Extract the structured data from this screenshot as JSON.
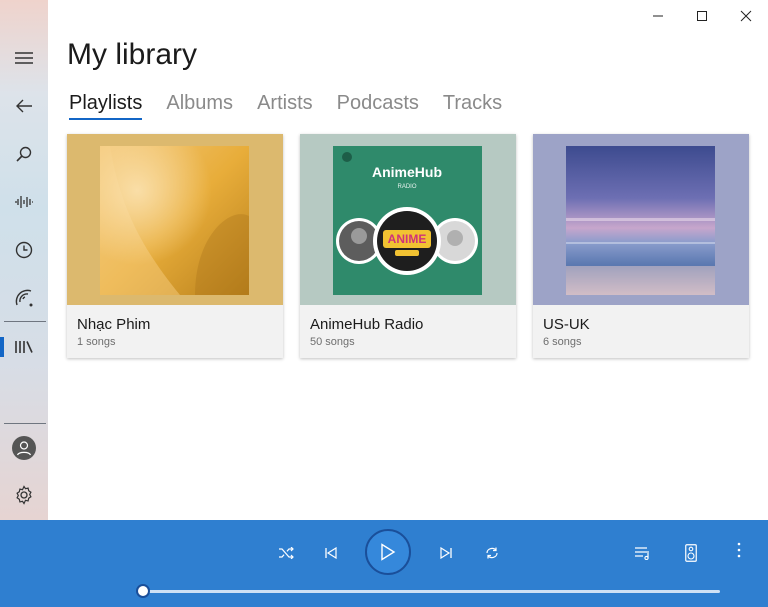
{
  "window": {
    "minimize_label": "Minimize",
    "maximize_label": "Maximize",
    "close_label": "Close"
  },
  "page": {
    "title": "My library"
  },
  "tabs": [
    {
      "label": "Playlists",
      "active": true
    },
    {
      "label": "Albums",
      "active": false
    },
    {
      "label": "Artists",
      "active": false
    },
    {
      "label": "Podcasts",
      "active": false
    },
    {
      "label": "Tracks",
      "active": false
    }
  ],
  "sidebar": {
    "items": [
      {
        "icon": "hamburger-menu-icon"
      },
      {
        "icon": "back-arrow-icon"
      },
      {
        "icon": "search-icon"
      },
      {
        "icon": "waveform-icon"
      },
      {
        "icon": "clock-icon"
      },
      {
        "icon": "radio-signal-icon"
      },
      {
        "icon": "library-icon",
        "active": true
      },
      {
        "icon": "user-avatar-icon"
      },
      {
        "icon": "gear-icon"
      }
    ],
    "accent_color": "#1366c6"
  },
  "playlists": [
    {
      "title": "Nhạc Phim",
      "subtitle": "1 songs",
      "bg_color": "#dcb96e"
    },
    {
      "title": "AnimeHub Radio",
      "subtitle": "50 songs",
      "bg_color": "#b6c9c2",
      "art_title": "AnimeHub",
      "art_subtitle": "RADIO",
      "badge_text": "ANIME"
    },
    {
      "title": "US-UK",
      "subtitle": "6 songs",
      "bg_color": "#9da3c7"
    }
  ],
  "player": {
    "bg_color": "#2f7fd0",
    "progress_fraction": 0.0,
    "controls": [
      "shuffle-icon",
      "previous-icon",
      "play-icon",
      "next-icon",
      "repeat-icon",
      "queue-icon",
      "speaker-icon",
      "more-icon"
    ]
  }
}
